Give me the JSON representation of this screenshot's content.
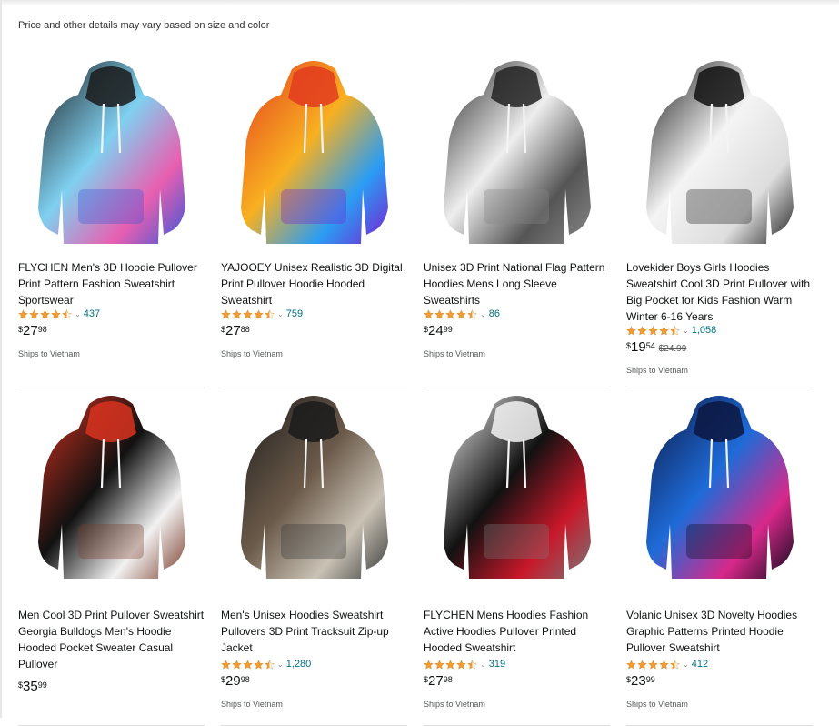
{
  "notice": "Price and other details may vary based on size and color",
  "products": [
    {
      "title": "FLYCHEN Men's 3D Hoodie Pullover Print Pattern Fashion Sweatshirt Sportswear",
      "rating": "4.5",
      "reviews": "437",
      "price_currency": "$",
      "price_whole": "27",
      "price_fraction": "98",
      "list_price": "",
      "shipping": "Ships to Vietnam",
      "image": "galaxy-drip-hoodie-image",
      "colors": [
        "#1a1a1a",
        "#7fd0f0",
        "#e85fb0",
        "#3a57d8"
      ]
    },
    {
      "title": "YAJOOEY Unisex Realistic 3D Digital Print Pullover Hoodie Hooded Sweatshirt",
      "rating": "4.5",
      "reviews": "759",
      "price_currency": "$",
      "price_whole": "27",
      "price_fraction": "88",
      "list_price": "",
      "shipping": "Ships to Vietnam",
      "image": "flame-hoodie-image",
      "colors": [
        "#e23b1f",
        "#f8b020",
        "#2a9df4",
        "#7a1fd0"
      ]
    },
    {
      "title": "Unisex 3D Print National Flag Pattern Hoodies Mens Long Sleeve Sweatshirts",
      "rating": "4.5",
      "reviews": "86",
      "price_currency": "$",
      "price_whole": "24",
      "price_fraction": "99",
      "list_price": "",
      "shipping": "Ships to Vietnam",
      "image": "flag-hoodie-image",
      "colors": [
        "#222",
        "#eee",
        "#555",
        "#888"
      ]
    },
    {
      "title": "Lovekider Boys Girls Hoodies Sweatshirt Cool 3D Print Pullover with Big Pocket for Kids Fashion Warm Winter 6-16 Years",
      "rating": "4.5",
      "reviews": "1,058",
      "price_currency": "$",
      "price_whole": "19",
      "price_fraction": "54",
      "list_price": "$24.99",
      "shipping": "Ships to Vietnam",
      "image": "black-white-drip-hoodie-image",
      "colors": [
        "#111",
        "#f4f4f4",
        "#ddd",
        "#222"
      ]
    },
    {
      "title": "Men Cool 3D Print Pullover Sweatshirt Georgia Bulldogs Men's Hoodie Hooded Pocket Sweater Casual Pullover",
      "rating": "",
      "reviews": "",
      "price_currency": "$",
      "price_whole": "35",
      "price_fraction": "99",
      "list_price": "",
      "shipping": "",
      "image": "bulldog-hoodie-image",
      "colors": [
        "#d8321f",
        "#111",
        "#f2f2f2",
        "#7a3c2a"
      ]
    },
    {
      "title": "Men's Unisex Hoodies Sweatshirt Pullovers 3D Print Tracksuit Zip-up Jacket",
      "rating": "4.5",
      "reviews": "1,280",
      "price_currency": "$",
      "price_whole": "29",
      "price_fraction": "98",
      "list_price": "",
      "shipping": "Ships to Vietnam",
      "image": "horror-zip-hoodie-image",
      "colors": [
        "#1b1b1b",
        "#6b5a4a",
        "#c9c2b5",
        "#3a3a3a"
      ]
    },
    {
      "title": "FLYCHEN Mens Hoodies Fashion Active Hoodies Pullover Printed Hooded Sweatshirt",
      "rating": "4.5",
      "reviews": "319",
      "price_currency": "$",
      "price_whole": "27",
      "price_fraction": "98",
      "list_price": "",
      "shipping": "Ships to Vietnam",
      "image": "venom-hoodie-image",
      "colors": [
        "#f3f3f3",
        "#111",
        "#c8182a",
        "#777"
      ]
    },
    {
      "title": "Volanic Unisex 3D Novelty Hoodies Graphic Patterns Printed Hoodie Pullover Sweatshirt",
      "rating": "4.5",
      "reviews": "412",
      "price_currency": "$",
      "price_whole": "23",
      "price_fraction": "99",
      "list_price": "",
      "shipping": "Ships to Vietnam",
      "image": "wolf-hoodie-image",
      "colors": [
        "#0c1640",
        "#1e6bd8",
        "#d8288a",
        "#0a0a1a"
      ]
    }
  ],
  "theme": {
    "star": "#f29c34",
    "link": "#007185",
    "divider": "#dddddd"
  }
}
